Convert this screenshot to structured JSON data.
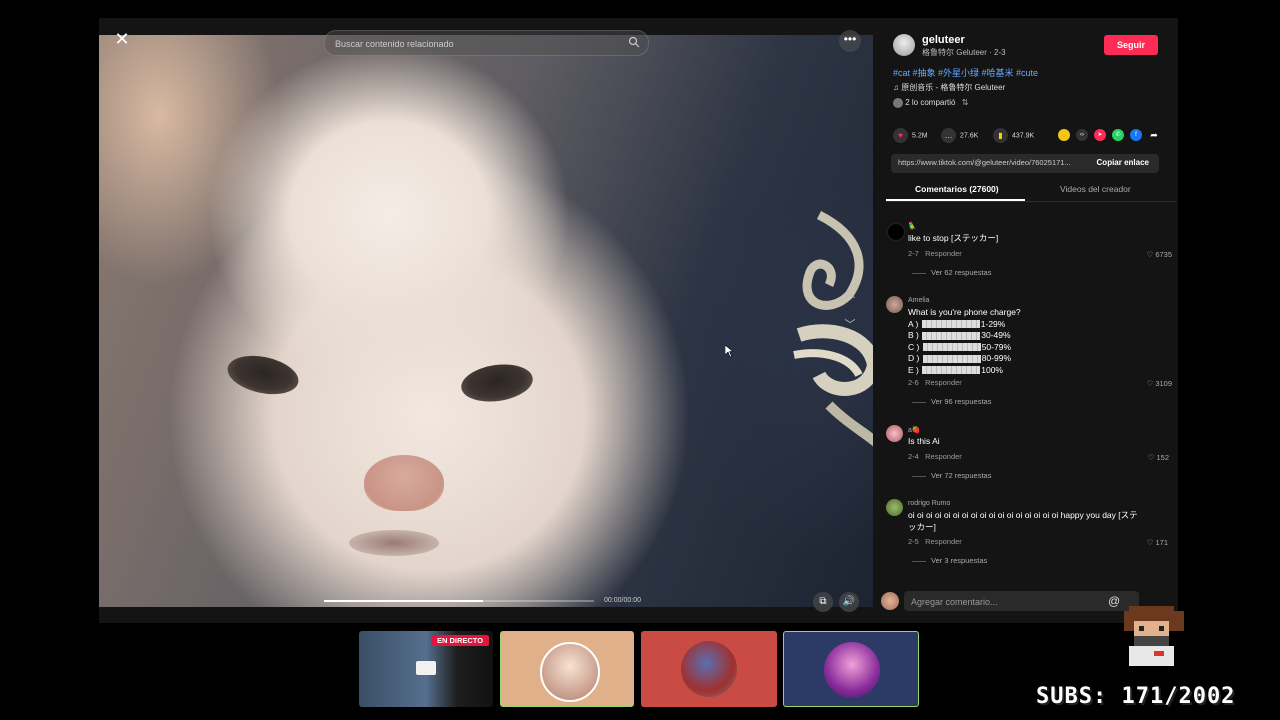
{
  "video": {
    "search_placeholder": "Buscar contenido relacionado",
    "close_symbol": "✕",
    "more_symbol": "•••",
    "time": "00:00/00:00",
    "progress": 0.59
  },
  "creator": {
    "name": "geluteer",
    "subtitle": "格鲁特尔 Geluteer · 2-3",
    "follow_label": "Seguir"
  },
  "description": {
    "tags": "#cat #抽象 #外星小绿 #哈基米 #cute",
    "music": "♫  原创音乐 - 格鲁特尔 Geluteer",
    "shared": "2 lo compartió"
  },
  "stats": {
    "likes": "5.2M",
    "comments": "27.6K",
    "saves": "437.9K"
  },
  "link": {
    "url": "https://www.tiktok.com/@geluteer/video/76025171...",
    "copy_label": "Copiar enlace"
  },
  "tabs": {
    "comments": "Comentarios (27600)",
    "creator_videos": "Videos del creador"
  },
  "comments": [
    {
      "name": "🦜",
      "text": "like to stop [ステッカー]",
      "date": "2-7",
      "reply": "Responder",
      "likes": "6735",
      "more": "Ver 62 respuestas"
    },
    {
      "name": "Amelia",
      "text": "What is you're phone charge?",
      "options": [
        "A ) ",
        "B ) ",
        "C ) ",
        "D ) ",
        "E ) "
      ],
      "option_values": [
        "1-29%",
        "30-49%",
        "50-79%",
        "80-99%",
        "100%"
      ],
      "date": "2-6",
      "reply": "Responder",
      "likes": "3109",
      "more": "Ver 96 respuestas"
    },
    {
      "name": "a🍓",
      "text": "Is this Ai",
      "date": "2-4",
      "reply": "Responder",
      "likes": "152",
      "more": "Ver 72 respuestas"
    },
    {
      "name": "rodrigo Rumo",
      "text": "oi oi oi oi oi oi oi oi oi oi oi oi oi oi oi oi oi happy you day [ステッカー]",
      "date": "2-5",
      "reply": "Responder",
      "likes": "171",
      "more": "Ver 3 respuestas"
    }
  ],
  "comment_input": {
    "placeholder": "Agregar comentario..."
  },
  "stream": {
    "live_label": "EN DIRECTO",
    "subs_text": "SUBS: 171/2002"
  },
  "colors": {
    "accent": "#fe2c55",
    "tag": "#66aaff",
    "live": "#e0163c"
  }
}
